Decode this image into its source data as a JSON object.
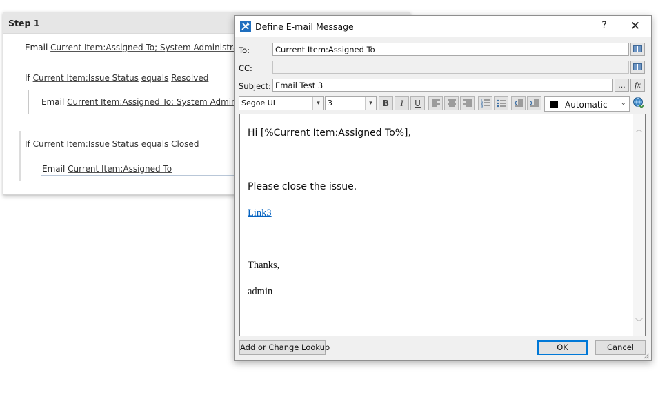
{
  "workflow": {
    "step_title": "Step 1",
    "line1": {
      "action": "Email",
      "value": "Current Item:Assigned To; System Administrator"
    },
    "line2": {
      "keyword": "If",
      "field": "Current Item:Issue Status",
      "op": "equals",
      "value": "Resolved"
    },
    "line3": {
      "action": "Email",
      "value": "Current Item:Assigned To; System Administrato"
    },
    "line4": {
      "keyword": "If",
      "field": "Current Item:Issue Status",
      "op": "equals",
      "value": "Closed"
    },
    "line5": {
      "action": "Email",
      "value": "Current Item:Assigned To"
    }
  },
  "dialog": {
    "title": "Define E-mail Message",
    "help_label": "?",
    "close_label": "✕",
    "to_label": "To:",
    "to_value": "Current Item:Assigned To",
    "cc_label": "CC:",
    "cc_value": "",
    "subject_label": "Subject:",
    "subject_value": "Email Test 3",
    "subject_ellipsis": "...",
    "fx_label": "fx",
    "font_name": "Segoe UI",
    "font_size": "3",
    "bold": "B",
    "italic": "I",
    "underline": "U",
    "color_label": "Automatic",
    "color_value": "#000000",
    "body": {
      "greeting": "Hi [%Current Item:Assigned To%],",
      "message": "Please close the issue.",
      "link": "Link3",
      "thanks": "Thanks,",
      "signature": "admin"
    },
    "lookup_button": "Add or Change Lookup",
    "ok_button": "OK",
    "cancel_button": "Cancel"
  }
}
